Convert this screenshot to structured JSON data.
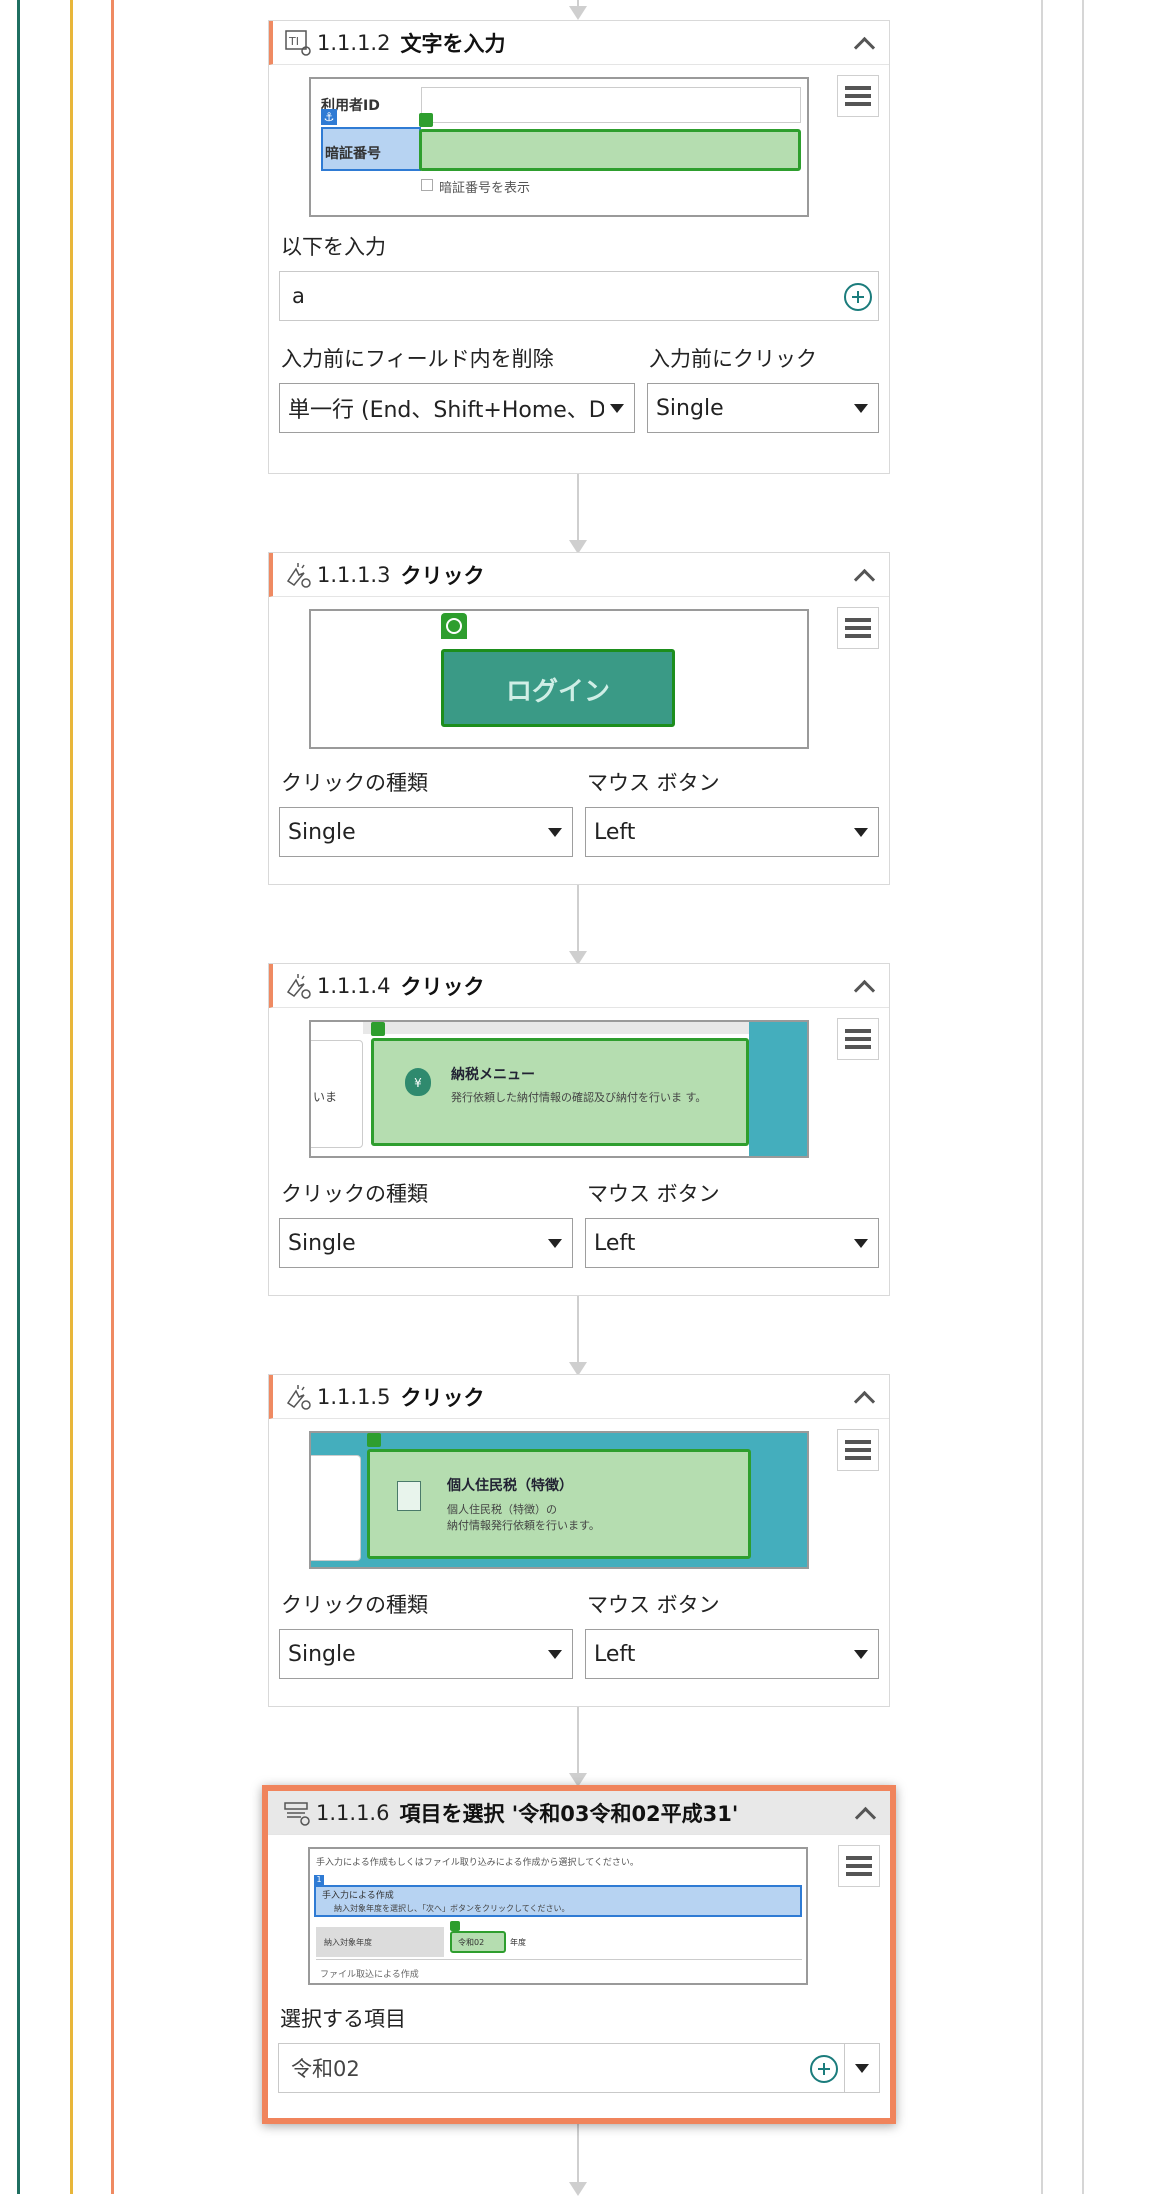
{
  "activities": [
    {
      "number": "1.1.1.2",
      "title": "文字を入力",
      "icon": "type-into-icon",
      "preview": {
        "user_id_label": "利用者ID",
        "password_label": "暗証番号",
        "show_password_label": "暗証番号を表示"
      },
      "input_label": "以下を入力",
      "input_value": "a",
      "clear_label": "入力前にフィールド内を削除",
      "clear_value": "単一行 (End、Shift+Home、Del)",
      "click_before_label": "入力前にクリック",
      "click_before_value": "Single"
    },
    {
      "number": "1.1.1.3",
      "title": "クリック",
      "icon": "click-icon",
      "preview": {
        "button_text": "ログイン"
      },
      "click_type_label": "クリックの種類",
      "click_type_value": "Single",
      "mouse_button_label": "マウス ボタン",
      "mouse_button_value": "Left"
    },
    {
      "number": "1.1.1.4",
      "title": "クリック",
      "icon": "click-icon",
      "preview": {
        "left_text": "いま",
        "menu_title": "納税メニュー",
        "menu_desc": "発行依頼した納付情報の確認及び納付を行いま す。"
      },
      "click_type_label": "クリックの種類",
      "click_type_value": "Single",
      "mouse_button_label": "マウス ボタン",
      "mouse_button_value": "Left"
    },
    {
      "number": "1.1.1.5",
      "title": "クリック",
      "icon": "click-icon",
      "preview": {
        "menu_title": "個人住民税（特徴）",
        "menu_desc1": "個人住民税（特徴）の",
        "menu_desc2": "納付情報発行依頼を行います。"
      },
      "click_type_label": "クリックの種類",
      "click_type_value": "Single",
      "mouse_button_label": "マウス ボタン",
      "mouse_button_value": "Left"
    },
    {
      "number": "1.1.1.6",
      "title": "項目を選択 '令和03令和02平成31'",
      "icon": "select-item-icon",
      "preview": {
        "line1": "手入力による作成もしくはファイル取り込みによる作成から選択してください。",
        "option1": "手入力による作成",
        "option1_desc": "納入対象年度を選択し、「次へ」ボタンをクリックしてください。",
        "year_label": "納入対象年度",
        "year_value": "令和02",
        "year_suffix": "年度",
        "option2": "ファイル取込による作成"
      },
      "select_label": "選択する項目",
      "select_value": "令和02"
    }
  ]
}
